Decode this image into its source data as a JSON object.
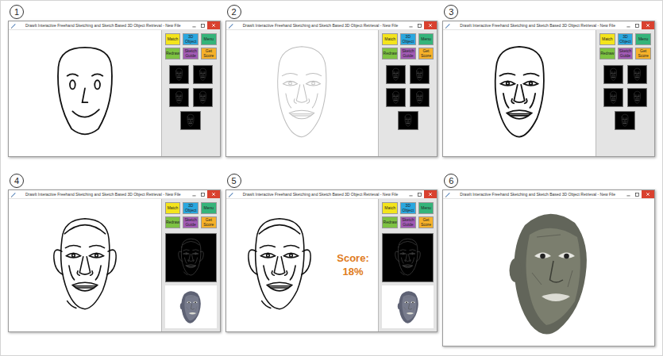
{
  "figure": {
    "panels": [
      {
        "number": "1",
        "kind": "sketch-app",
        "stage": "simple",
        "thumbnails": "grid",
        "window": {
          "title": "DrawIt Interactive Freehand Sketching and Sketch Based 3D Object Retrieval - New File"
        },
        "buttons": [
          {
            "label": "Match",
            "color": "#f4e41c"
          },
          {
            "label": "3D Object",
            "color": "#2aa7df"
          },
          {
            "label": "Menu",
            "color": "#35b47a"
          },
          {
            "label": "Redraw",
            "color": "#7dc242"
          },
          {
            "label": "Sketch Guide",
            "color": "#a25bb5"
          },
          {
            "label": "Get Score",
            "color": "#f6b12a"
          }
        ]
      },
      {
        "number": "2",
        "kind": "sketch-app",
        "stage": "guide",
        "thumbnails": "grid",
        "window": {
          "title": "DrawIt Interactive Freehand Sketching and Sketch Based 3D Object Retrieval - New File"
        },
        "buttons": [
          {
            "label": "Match",
            "color": "#f4e41c"
          },
          {
            "label": "3D Object",
            "color": "#2aa7df"
          },
          {
            "label": "Menu",
            "color": "#35b47a"
          },
          {
            "label": "Redraw",
            "color": "#7dc242"
          },
          {
            "label": "Sketch Guide",
            "color": "#a25bb5"
          },
          {
            "label": "Get Score",
            "color": "#f6b12a"
          }
        ]
      },
      {
        "number": "3",
        "kind": "sketch-app",
        "stage": "traced",
        "thumbnails": "grid",
        "window": {
          "title": "DrawIt Interactive Freehand Sketching and Sketch Based 3D Object Retrieval - New File"
        },
        "buttons": [
          {
            "label": "Match",
            "color": "#f4e41c"
          },
          {
            "label": "3D Object",
            "color": "#2aa7df"
          },
          {
            "label": "Menu",
            "color": "#35b47a"
          },
          {
            "label": "Redraw",
            "color": "#7dc242"
          },
          {
            "label": "Sketch Guide",
            "color": "#a25bb5"
          },
          {
            "label": "Get Score",
            "color": "#f6b12a"
          }
        ]
      },
      {
        "number": "4",
        "kind": "sketch-app",
        "stage": "final",
        "thumbnails": "single-with-model",
        "window": {
          "title": "DrawIt Interactive Freehand Sketching and Sketch Based 3D Object Retrieval - New File"
        },
        "buttons": [
          {
            "label": "Match",
            "color": "#f4e41c"
          },
          {
            "label": "3D Object",
            "color": "#2aa7df"
          },
          {
            "label": "Menu",
            "color": "#35b47a"
          },
          {
            "label": "Redraw",
            "color": "#7dc242"
          },
          {
            "label": "Sketch Guide",
            "color": "#a25bb5"
          },
          {
            "label": "Get Score",
            "color": "#f6b12a"
          }
        ]
      },
      {
        "number": "5",
        "kind": "sketch-app",
        "stage": "final",
        "thumbnails": "single-with-model",
        "window": {
          "title": "DrawIt Interactive Freehand Sketching and Sketch Based 3D Object Retrieval - New File"
        },
        "score": {
          "label": "Score:",
          "value": "18%"
        },
        "buttons": [
          {
            "label": "Match",
            "color": "#f4e41c"
          },
          {
            "label": "3D Object",
            "color": "#2aa7df"
          },
          {
            "label": "Menu",
            "color": "#35b47a"
          },
          {
            "label": "Redraw",
            "color": "#7dc242"
          },
          {
            "label": "Sketch Guide",
            "color": "#a25bb5"
          },
          {
            "label": "Get Score",
            "color": "#f6b12a"
          }
        ]
      },
      {
        "number": "6",
        "kind": "model-view",
        "window": {
          "title": "DrawIt Interactive Freehand Sketching and Sketch Based 3D Object Retrieval - New File"
        }
      }
    ]
  }
}
